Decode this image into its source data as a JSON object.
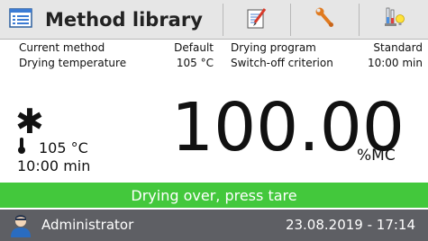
{
  "header": {
    "title": "Method library",
    "icons": [
      "method-library-icon",
      "edit-icon",
      "wrench-icon",
      "test-tube-lightbulb-icon"
    ]
  },
  "info": {
    "current_method_label": "Current method",
    "current_method_value": "Default",
    "drying_temp_label": "Drying temperature",
    "drying_temp_value": "105 °C",
    "drying_program_label": "Drying program",
    "drying_program_value": "Standard",
    "switch_off_label": "Switch-off criterion",
    "switch_off_value": "10:00 min"
  },
  "result": {
    "value": "100.00",
    "unit": "%MC",
    "marker": "✱"
  },
  "conditions": {
    "temperature": "105 °C",
    "time": "10:00 min"
  },
  "status": {
    "message": "Drying over, press tare",
    "color": "#43c83c"
  },
  "footer": {
    "user": "Administrator",
    "datetime": "23.08.2019 - 17:14",
    "bar_color": "#5e5f64"
  }
}
